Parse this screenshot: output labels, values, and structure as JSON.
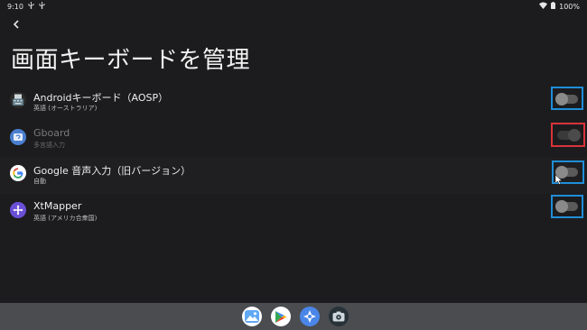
{
  "status_bar": {
    "time": "9:10",
    "left_icons": [
      "usb-icon",
      "usb-icon"
    ],
    "battery": "100%"
  },
  "title": "画面キーボードを管理",
  "keyboards": [
    {
      "label": "Androidキーボード（AOSP）",
      "sub": "英語 (オーストラリア)",
      "icon": "keyboard-icon",
      "enabled": false,
      "disabled": false,
      "outline": "#1f8ed8"
    },
    {
      "label": "Gboard",
      "sub": "多言語入力",
      "icon": "gboard-icon",
      "enabled": true,
      "disabled": true,
      "outline": "#d8343a"
    },
    {
      "label": "Google 音声入力（旧バージョン）",
      "sub": "自動",
      "icon": "google-icon",
      "enabled": false,
      "disabled": false,
      "outline": "#1f8ed8"
    },
    {
      "label": "XtMapper",
      "sub": "英語 (アメリカ合衆国)",
      "icon": "xtmapper-icon",
      "enabled": false,
      "disabled": false,
      "outline": "#1f8ed8"
    }
  ],
  "dock": [
    "photos-icon",
    "play-store-icon",
    "compass-app-icon",
    "camera-icon"
  ]
}
